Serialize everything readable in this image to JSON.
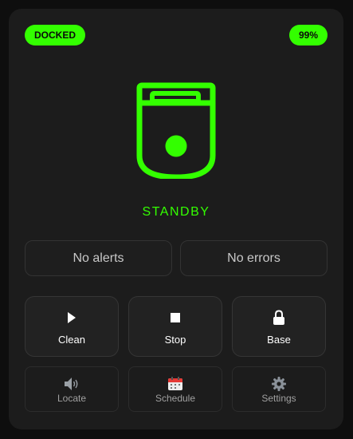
{
  "header": {
    "state_badge": "DOCKED",
    "battery_badge": "99%"
  },
  "status": {
    "text": "STANDBY"
  },
  "info": {
    "alerts": "No alerts",
    "errors": "No errors"
  },
  "primary_actions": [
    {
      "label": "Clean",
      "icon": "play-icon"
    },
    {
      "label": "Stop",
      "icon": "stop-icon"
    },
    {
      "label": "Base",
      "icon": "lock-icon"
    }
  ],
  "secondary_actions": [
    {
      "label": "Locate",
      "icon": "speaker-icon"
    },
    {
      "label": "Schedule",
      "icon": "calendar-icon"
    },
    {
      "label": "Settings",
      "icon": "gear-icon"
    }
  ],
  "colors": {
    "accent": "#33ff00",
    "card_background": "#1c1c1c",
    "page_background": "#0e0e0e"
  }
}
